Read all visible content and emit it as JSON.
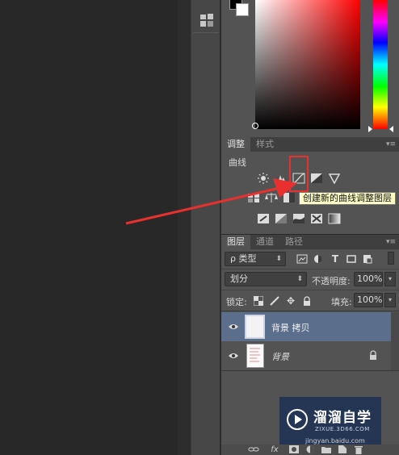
{
  "adjustments_panel": {
    "tabs": [
      "调整",
      "样式"
    ],
    "current_label": "曲线",
    "tooltip": "创建新的曲线调整图层"
  },
  "layers_panel": {
    "tabs": [
      "图层",
      "通道",
      "路径"
    ],
    "filter_kind": "ρ 类型",
    "blend_mode": "划分",
    "opacity_label": "不透明度:",
    "opacity_value": "100%",
    "lock_label": "锁定:",
    "fill_label": "填充:",
    "fill_value": "100%",
    "layers": [
      {
        "name": "背景 拷贝",
        "selected": true
      },
      {
        "name": "背景",
        "selected": false
      }
    ]
  },
  "watermark": {
    "brand": "溜溜自学",
    "url": "ZIXUE.3D66.COM",
    "url2": "jingyan.baidu.com"
  },
  "colors": {
    "accent_red": "#e8312f",
    "selected_layer": "#5b6e8c",
    "panel_bg": "#535353"
  }
}
